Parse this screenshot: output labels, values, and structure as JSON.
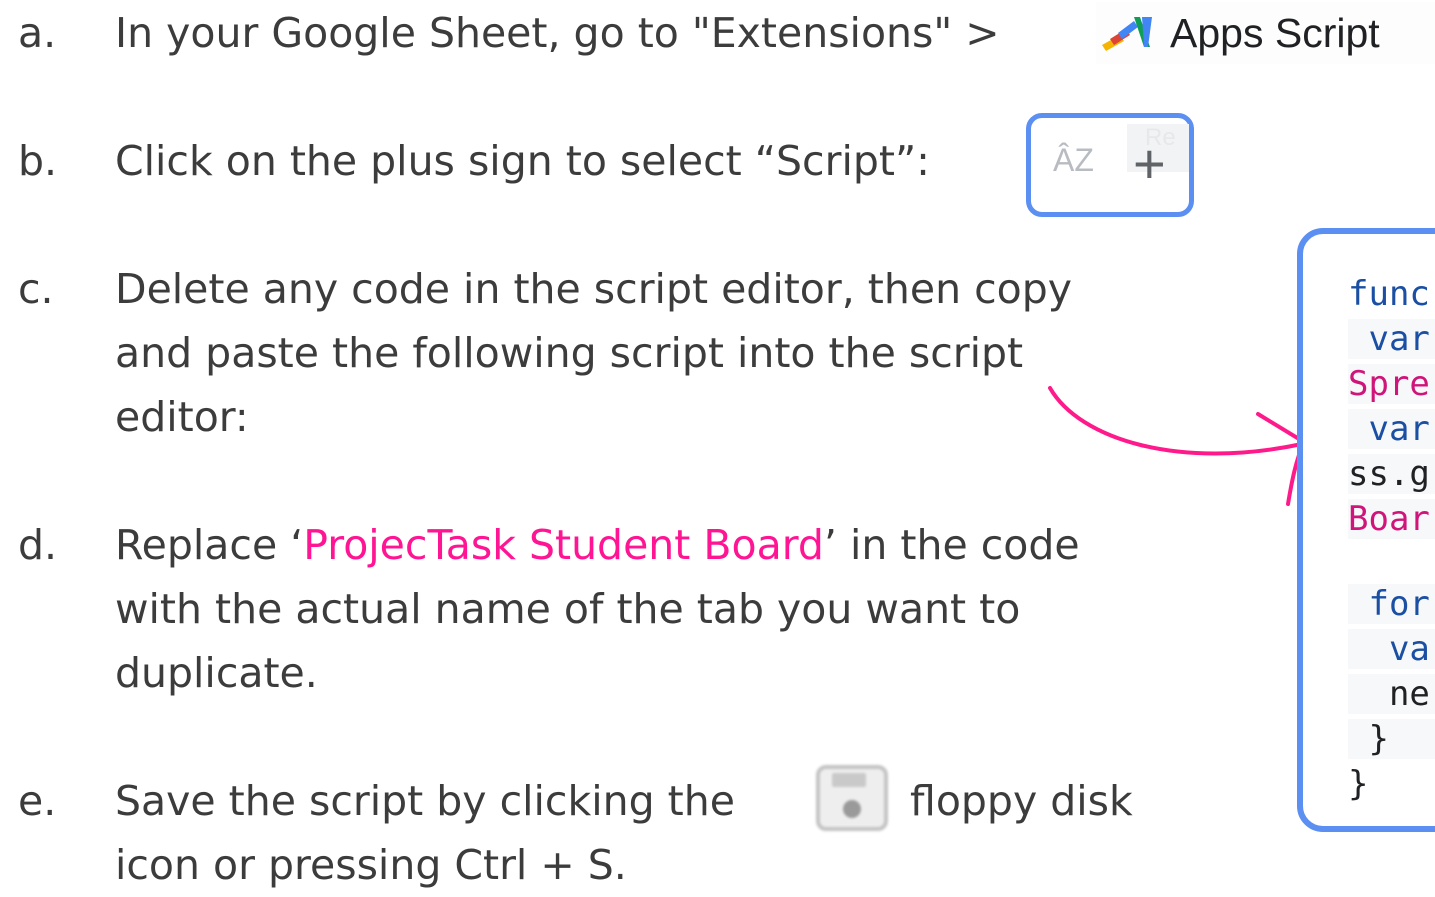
{
  "steps": [
    {
      "marker": "a.",
      "lines": [
        "In your Google Sheet, go to \"Extensions\" >"
      ]
    },
    {
      "marker": "b.",
      "lines": [
        "Click on the plus sign to select “Script”:"
      ]
    },
    {
      "marker": "c.",
      "lines": [
        "Delete any code in the script editor, then copy",
        "and paste the following script into the script",
        "editor:"
      ]
    },
    {
      "marker": "d.",
      "line1_before": "Replace ‘",
      "highlight": "ProjecTask Student Board",
      "line1_after": "’ in the code",
      "lines_rest": [
        "with the actual name of the tab you want to",
        "duplicate."
      ]
    },
    {
      "marker": "e.",
      "line1_before": "Save the script by clicking the",
      "line1_after": "floppy disk",
      "line2": "icon or pressing Ctrl + S."
    }
  ],
  "apps_script_label": "Apps Script",
  "sort_icon_text": "ÂZ",
  "rename_ghost_text": "Re",
  "plus_glyph": "+",
  "code_lines": [
    "func",
    " var",
    "Spre",
    " var",
    "ss.g",
    "Boar",
    "",
    " for",
    "  va",
    "  ne",
    " }",
    "}"
  ],
  "colors": {
    "text": "#3c3c3c",
    "highlight": "#ff1493",
    "frame": "#5b8ff2",
    "code_keyword": "#1a4fa3",
    "code_string": "#d0157a"
  },
  "icons": [
    "apps-script-icon",
    "sort-az-icon",
    "plus-icon",
    "floppy-disk-icon",
    "curved-arrow"
  ]
}
